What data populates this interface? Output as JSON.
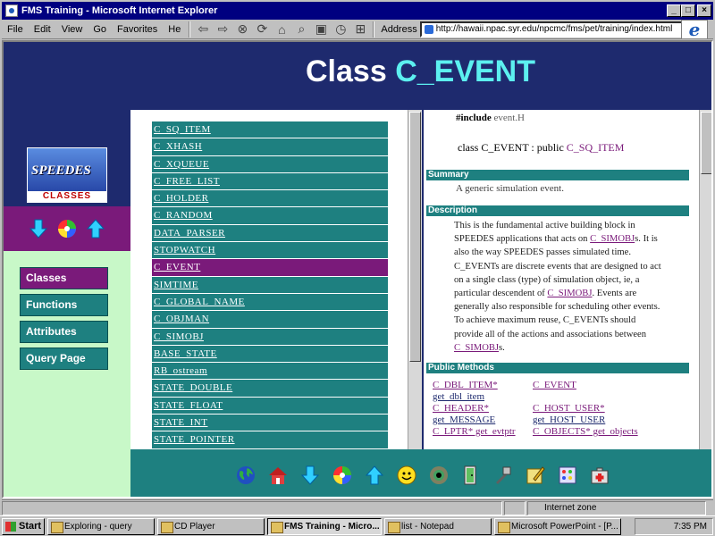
{
  "window": {
    "title": "FMS Training - Microsoft Internet Explorer"
  },
  "menu": [
    "File",
    "Edit",
    "View",
    "Go",
    "Favorites",
    "He"
  ],
  "address": {
    "label": "Address",
    "url": "http://hawaii.npac.syr.edu/npcmc/fms/pet/training/index.html"
  },
  "page": {
    "title_prefix": "Class ",
    "title_class": "C_EVENT"
  },
  "logo": {
    "top_text": "",
    "main_text": "SPEEDES",
    "sub_text": "CLASSES"
  },
  "nav": {
    "items": [
      "Classes",
      "Functions",
      "Attributes",
      "Query Page"
    ]
  },
  "classes": [
    "C_SQ_ITEM",
    "C_XHASH",
    "C_XQUEUE",
    "C_FREE_LIST",
    "C_HOLDER",
    "C_RANDOM",
    "DATA_PARSER",
    "STOPWATCH",
    "C_EVENT",
    "SIMTIME",
    "C_GLOBAL_NAME",
    "C_OBJMAN",
    "C_SIMOBJ",
    "BASE_STATE",
    "RB_ostream",
    "STATE_DOUBLE",
    "STATE_FLOAT",
    "STATE_INT",
    "STATE_POINTER"
  ],
  "active_class": "C_EVENT",
  "detail": {
    "include_kw": "#include",
    "include_file": "event.H",
    "class_prefix": "class C_EVENT : public ",
    "class_parent": "C_SQ_ITEM",
    "summary_header": "Summary",
    "summary_text": "A generic simulation event.",
    "description_header": "Description",
    "desc_1": "This is the fundamental active building block in SPEEDES applications that acts on ",
    "desc_link1": "C_SIMOBJ",
    "desc_2": "s. It is also the way SPEEDES passes simulated time. C_EVENTs are discrete events that are designed to act on a single class (type) of simulation object, ie, a particular descendent of ",
    "desc_link2": "C_SIMOBJ",
    "desc_3": ". Events are generally also responsible for scheduling other events. To achieve maximum reuse, C_EVENTs should provide all of the actions and associations between ",
    "desc_link3": "C_SIMOBJ",
    "desc_4": "s.",
    "methods_header": "Public Methods",
    "methods": [
      [
        "C_DBL_ITEM*",
        "C_EVENT"
      ],
      [
        "get_dbl_item",
        ""
      ],
      [
        "C_HEADER*",
        "C_HOST_USER*"
      ],
      [
        "get_MESSAGE",
        "get_HOST_USER"
      ],
      [
        "C_LPTR* get_evtptr",
        "C_OBJECTS* get_objects"
      ]
    ]
  },
  "status": {
    "zone": "Internet zone"
  },
  "taskbar": {
    "start": "Start",
    "tasks": [
      "Exploring - query",
      "CD Player",
      "FMS Training - Micro...",
      "list - Notepad",
      "Microsoft PowerPoint - [P..."
    ],
    "clock": "7:35 PM"
  }
}
